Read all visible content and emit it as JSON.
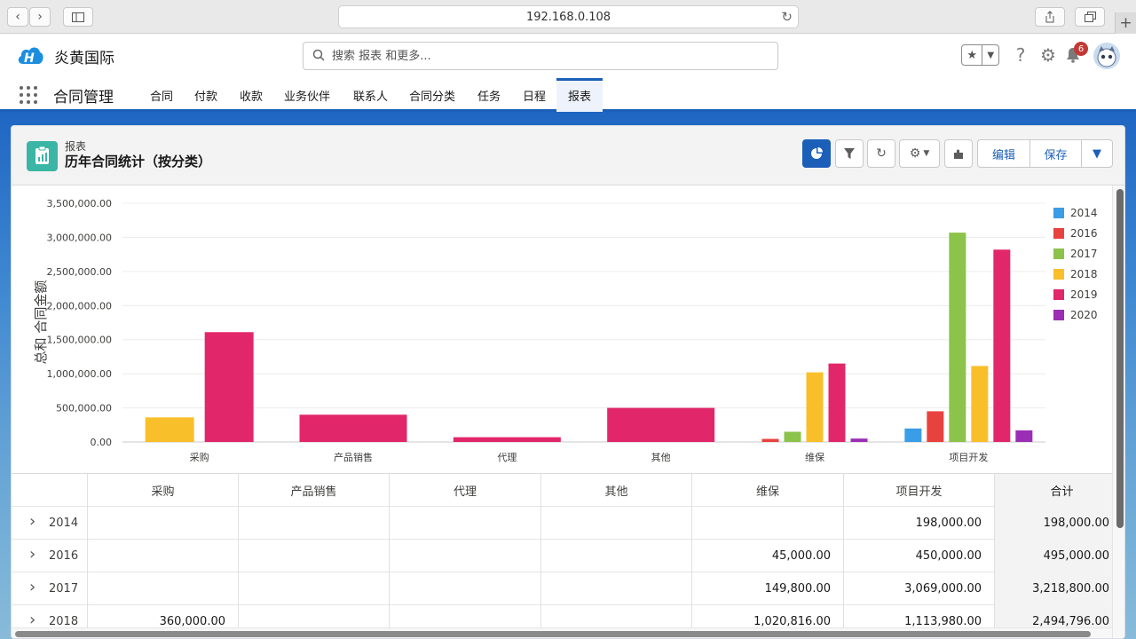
{
  "browser": {
    "url": "192.168.0.108"
  },
  "app": {
    "brand": "炎黄国际",
    "app_name": "合同管理"
  },
  "search": {
    "placeholder": "搜索 报表 和更多..."
  },
  "header": {
    "notifications": "6"
  },
  "nav": {
    "items": [
      {
        "label": "合同"
      },
      {
        "label": "付款"
      },
      {
        "label": "收款"
      },
      {
        "label": "业务伙伴"
      },
      {
        "label": "联系人"
      },
      {
        "label": "合同分类"
      },
      {
        "label": "任务"
      },
      {
        "label": "日程"
      },
      {
        "label": "报表"
      }
    ],
    "active": "报表"
  },
  "report": {
    "object_label": "报表",
    "title": "历年合同统计（按分类）",
    "edit_label": "编辑",
    "save_label": "保存"
  },
  "chart_data": {
    "type": "bar",
    "categories": [
      "采购",
      "产品销售",
      "代理",
      "其他",
      "维保",
      "项目开发"
    ],
    "ylabel": "总和 合同金额",
    "ylim": [
      0,
      3500000
    ],
    "yticks": [
      "0.00",
      "500,000.00",
      "1,000,000.00",
      "1,500,000.00",
      "2,000,000.00",
      "2,500,000.00",
      "3,000,000.00",
      "3,500,000.00"
    ],
    "legend_position": "right",
    "series": [
      {
        "name": "2014",
        "color": "#3a9de6",
        "values": [
          null,
          null,
          null,
          null,
          null,
          198000
        ]
      },
      {
        "name": "2016",
        "color": "#e8423f",
        "values": [
          null,
          null,
          null,
          null,
          45000,
          450000
        ]
      },
      {
        "name": "2017",
        "color": "#8cc34a",
        "values": [
          null,
          null,
          null,
          null,
          149800,
          3069000
        ]
      },
      {
        "name": "2018",
        "color": "#f9bf2a",
        "values": [
          360000,
          null,
          null,
          null,
          1020816,
          1113980
        ]
      },
      {
        "name": "2019",
        "color": "#e2266a",
        "values": [
          1610000,
          400000,
          70000,
          500000,
          1150000,
          2820000
        ]
      },
      {
        "name": "2020",
        "color": "#9b2eb4",
        "values": [
          null,
          null,
          null,
          null,
          50000,
          170000
        ]
      }
    ]
  },
  "table": {
    "headers": [
      "采购",
      "产品销售",
      "代理",
      "其他",
      "维保",
      "项目开发",
      "合计"
    ],
    "rows": [
      {
        "year": "2014",
        "cells": [
          "",
          "",
          "",
          "",
          "",
          "198,000.00",
          "198,000.00"
        ]
      },
      {
        "year": "2016",
        "cells": [
          "",
          "",
          "",
          "",
          "45,000.00",
          "450,000.00",
          "495,000.00"
        ]
      },
      {
        "year": "2017",
        "cells": [
          "",
          "",
          "",
          "",
          "149,800.00",
          "3,069,000.00",
          "3,218,800.00"
        ]
      },
      {
        "year": "2018",
        "cells": [
          "360,000.00",
          "",
          "",
          "",
          "1,020,816.00",
          "1,113,980.00",
          "2,494,796.00"
        ]
      }
    ]
  }
}
